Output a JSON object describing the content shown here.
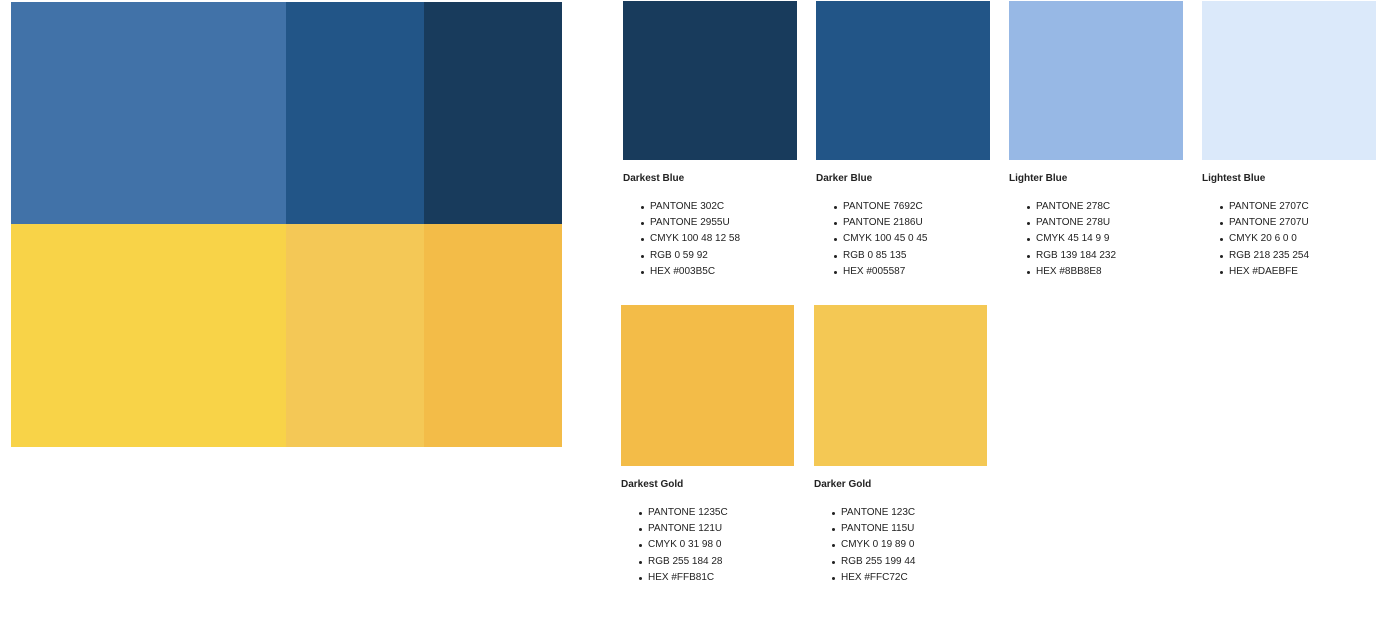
{
  "palette_block": {
    "colors": {
      "medium_blue": "#4172A8",
      "darker_blue": "#225587",
      "darkest_blue": "#183B5C",
      "yellow": "#F8D348",
      "darker_gold": "#F4C856",
      "darkest_gold": "#F3BC48"
    }
  },
  "swatches": [
    {
      "name": "Darkest Blue",
      "color": "#003B5C",
      "specs": [
        "PANTONE 302C",
        "PANTONE 2955U",
        "CMYK 100 48 12 58",
        "RGB 0 59 92",
        "HEX #003B5C"
      ]
    },
    {
      "name": "Darker Blue",
      "color": "#005587",
      "specs": [
        "PANTONE 7692C",
        "PANTONE 2186U",
        "CMYK 100 45 0 45",
        "RGB 0 85 135",
        "HEX #005587"
      ]
    },
    {
      "name": "Lighter Blue",
      "color": "#8BB8E8",
      "specs": [
        "PANTONE 278C",
        "PANTONE 278U",
        "CMYK 45 14 9 9",
        "RGB 139 184 232",
        "HEX #8BB8E8"
      ]
    },
    {
      "name": "Lightest Blue",
      "color": "#DAEBFE",
      "specs": [
        "PANTONE 2707C",
        "PANTONE 2707U",
        "CMYK 20 6 0 0",
        "RGB 218 235 254",
        "HEX #DAEBFE"
      ]
    },
    {
      "name": "Darkest Gold",
      "color": "#FFB81C",
      "specs": [
        "PANTONE 1235C",
        "PANTONE 121U",
        "CMYK 0 31 98 0",
        "RGB 255 184 28",
        "HEX #FFB81C"
      ]
    },
    {
      "name": "Darker Gold",
      "color": "#FFC72C",
      "specs": [
        "PANTONE 123C",
        "PANTONE 115U",
        "CMYK 0 19 89 0",
        "RGB 255 199 44",
        "HEX #FFC72C"
      ]
    }
  ]
}
